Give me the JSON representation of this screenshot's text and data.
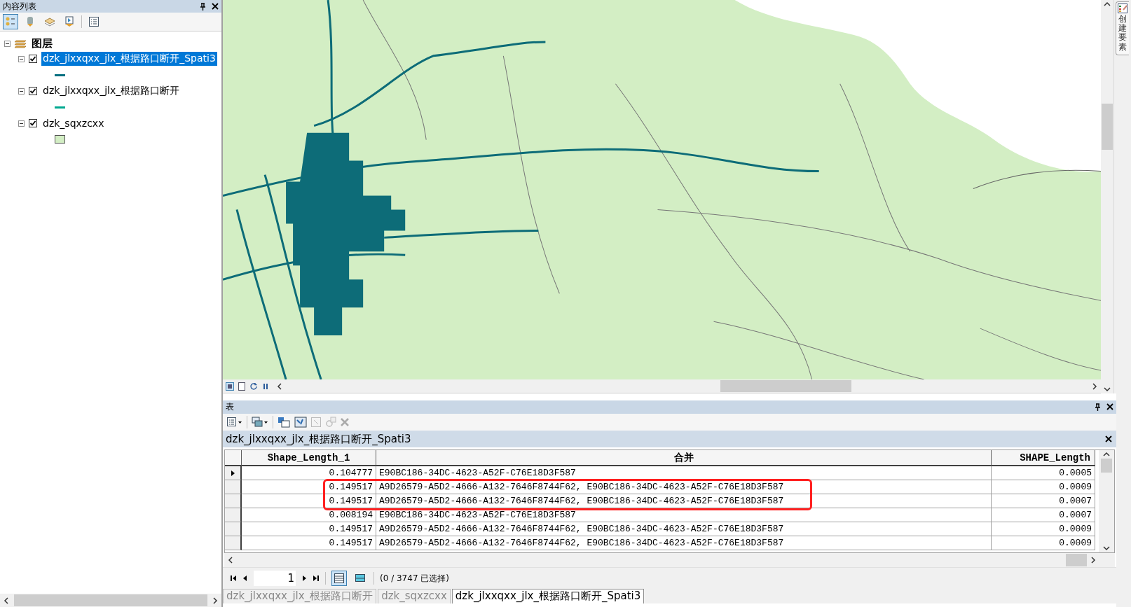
{
  "toc": {
    "title": "内容列表",
    "root": {
      "label": "图层",
      "expanded": true,
      "children": [
        {
          "label": "dzk_jlxxqxx_jlx_根据路口断开_Spati3",
          "checked": true,
          "selected": true,
          "expanded": true,
          "kind": "line",
          "color": "#006e7f"
        },
        {
          "label": "dzk_jlxxqxx_jlx_根据路口断开",
          "checked": true,
          "selected": false,
          "expanded": true,
          "kind": "line",
          "color": "#00a890"
        },
        {
          "label": "dzk_sqxzcxx",
          "checked": true,
          "selected": false,
          "expanded": true,
          "kind": "fill",
          "color": "#d3eec4"
        }
      ]
    }
  },
  "side_tab": {
    "label": "创建要素"
  },
  "table": {
    "title": "表",
    "layer_title": "dzk_jlxxqxx_jlx_根据路口断开_Spati3",
    "columns": [
      {
        "label": "Shape_Length_1"
      },
      {
        "label": "合并"
      },
      {
        "label": "SHAPE_Length"
      }
    ],
    "rows": [
      {
        "current": true,
        "marked": false,
        "cells": [
          "0.104777",
          "E90BC186-34DC-4623-A52F-C76E18D3F587",
          "0.0005"
        ]
      },
      {
        "current": false,
        "marked": true,
        "cells": [
          "0.149517",
          "A9D26579-A5D2-4666-A132-7646F8744F62, E90BC186-34DC-4623-A52F-C76E18D3F587",
          "0.0009"
        ]
      },
      {
        "current": false,
        "marked": true,
        "cells": [
          "0.149517",
          "A9D26579-A5D2-4666-A132-7646F8744F62, E90BC186-34DC-4623-A52F-C76E18D3F587",
          "0.0007"
        ]
      },
      {
        "current": false,
        "marked": false,
        "cells": [
          "0.008194",
          "E90BC186-34DC-4623-A52F-C76E18D3F587",
          "0.0007"
        ]
      },
      {
        "current": false,
        "marked": false,
        "cells": [
          "0.149517",
          "A9D26579-A5D2-4666-A132-7646F8744F62, E90BC186-34DC-4623-A52F-C76E18D3F587",
          "0.0009"
        ]
      },
      {
        "current": false,
        "marked": false,
        "cells": [
          "0.149517",
          "A9D26579-A5D2-4666-A132-7646F8744F62, E90BC186-34DC-4623-A52F-C76E18D3F587",
          "0.0009"
        ]
      }
    ],
    "page": "1",
    "views": [
      {
        "selected": true
      },
      {
        "selected": false
      }
    ],
    "status": "(0 / 3747 已选择)"
  },
  "bottom_tabs": [
    {
      "label": "dzk_jlxxqxx_jlx_根据路口断开",
      "selected": false
    },
    {
      "label": "dzk_sqxzcxx",
      "selected": false
    },
    {
      "label": "dzk_jlxxqxx_jlx_根据路口断开_Spati3",
      "selected": true
    }
  ]
}
